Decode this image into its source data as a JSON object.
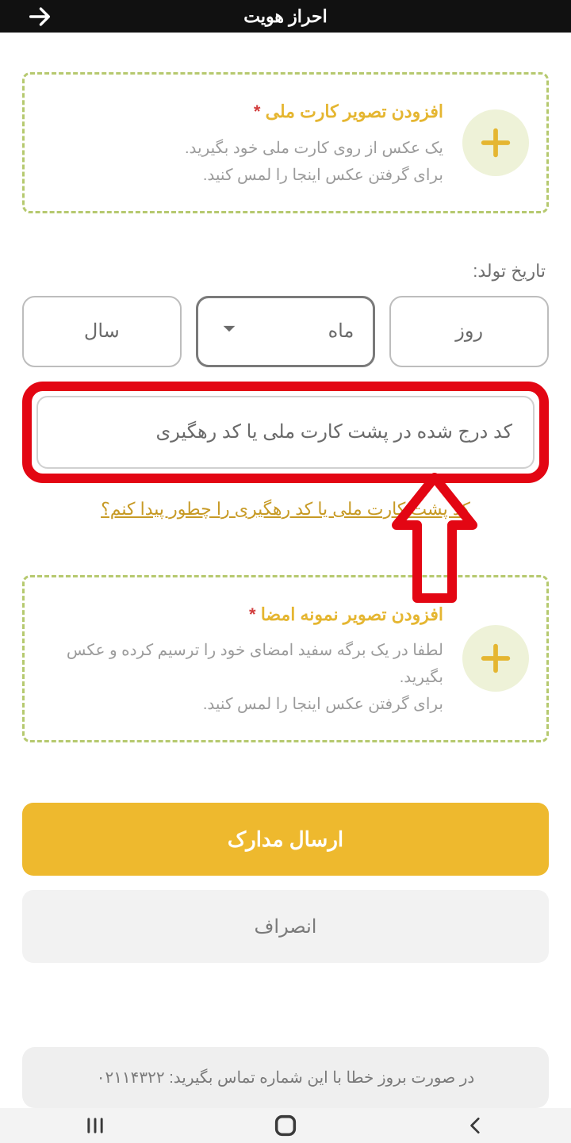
{
  "header": {
    "title": "احراز هویت"
  },
  "card_id": {
    "title": "افزودن تصویر کارت ملی",
    "required_mark": "*",
    "line1": "یک عکس از روی کارت ملی خود بگیرید.",
    "line2": "برای گرفتن عکس اینجا را لمس کنید."
  },
  "birth": {
    "label": "تاریخ تولد:",
    "day": "روز",
    "month": "ماه",
    "year": "سال"
  },
  "code": {
    "placeholder": "کد درج شده در پشت کارت ملی یا کد رهگیری"
  },
  "help_link": "کد پشت کارت ملی یا کد رهگیری را چطور پیدا کنم؟",
  "card_sign": {
    "title": "افزودن تصویر نمونه امضا",
    "required_mark": "*",
    "line1": "لطفا در یک برگه سفید امضای خود را ترسیم کرده و عکس بگیرید.",
    "line2": "برای گرفتن عکس اینجا را لمس کنید."
  },
  "buttons": {
    "submit": "ارسال مدارک",
    "cancel": "انصراف"
  },
  "contact": "در صورت بروز خطا با این شماره تماس بگیرید: ۰۲۱۱۴۳۲۲"
}
